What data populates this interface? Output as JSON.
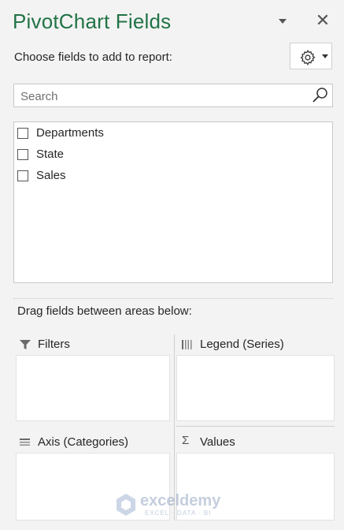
{
  "panel": {
    "title": "PivotChart Fields",
    "close_symbol": "✕",
    "choose_label": "Choose fields to add to report:",
    "accent_color": "#217346"
  },
  "tools": {
    "icon": "gear-icon"
  },
  "search": {
    "placeholder": "Search",
    "value": ""
  },
  "fields": [
    {
      "label": "Departments",
      "checked": false
    },
    {
      "label": "State",
      "checked": false
    },
    {
      "label": "Sales",
      "checked": false
    }
  ],
  "areas": {
    "drag_label": "Drag fields between areas below:",
    "filters": {
      "label": "Filters",
      "icon": "filter-icon"
    },
    "legend": {
      "label": "Legend (Series)",
      "icon": "columns-icon"
    },
    "axis": {
      "label": "Axis (Categories)",
      "icon": "rows-icon"
    },
    "values": {
      "label": "Values",
      "symbol": "Σ",
      "icon": "sigma-icon"
    }
  },
  "watermark": {
    "name": "exceldemy",
    "tagline": "EXCEL · DATA · BI"
  }
}
